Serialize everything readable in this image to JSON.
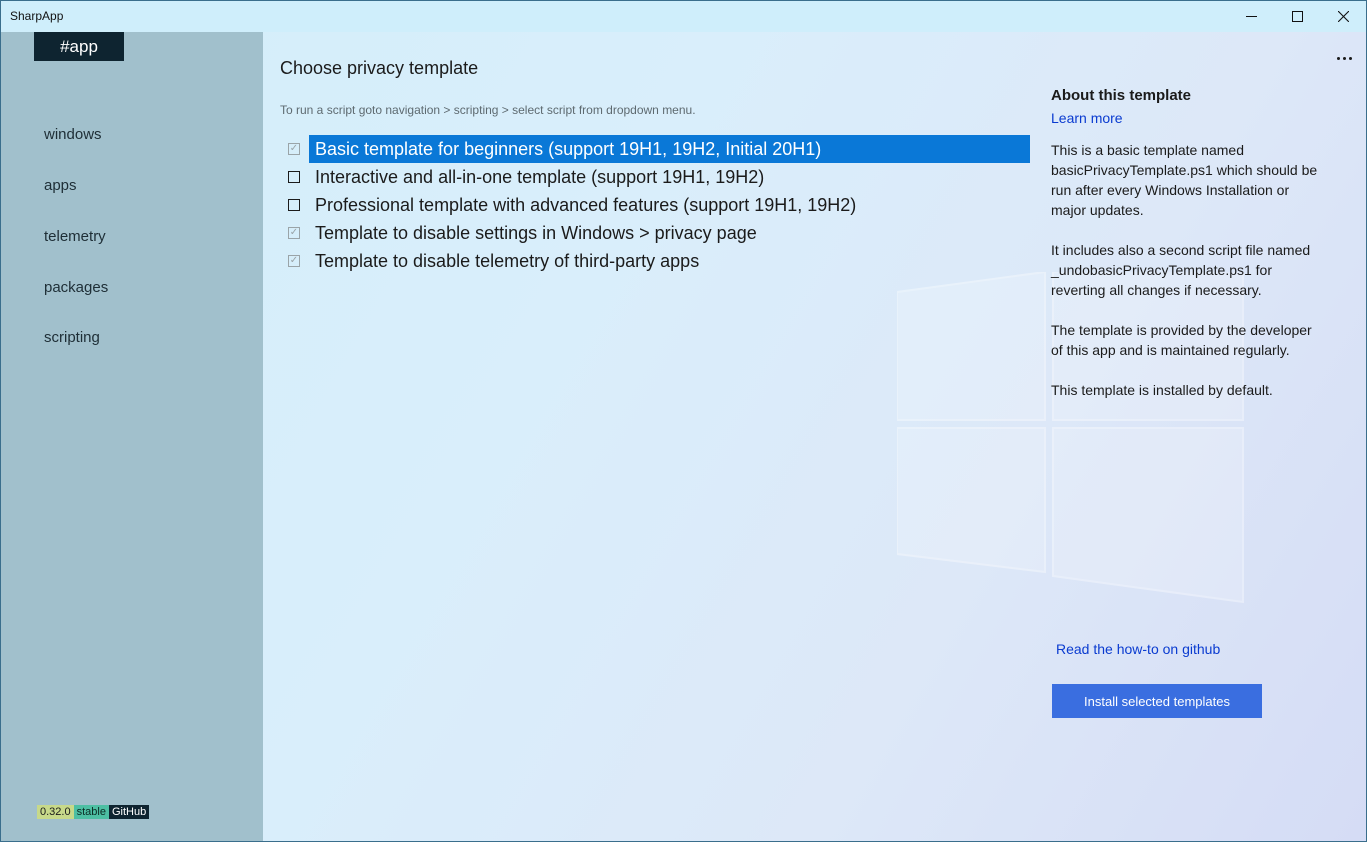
{
  "window": {
    "title": "SharpApp",
    "controls": {
      "minimize": "minimize-icon",
      "maximize": "maximize-icon",
      "close": "close-icon"
    }
  },
  "sidebar": {
    "app_badge": "#app",
    "items": [
      {
        "label": "windows"
      },
      {
        "label": "apps"
      },
      {
        "label": "telemetry"
      },
      {
        "label": "packages"
      },
      {
        "label": "scripting"
      }
    ],
    "badges": {
      "version": "0.32.0",
      "channel": "stable",
      "source": "GitHub"
    }
  },
  "main": {
    "title": "Choose privacy template",
    "hint": "To run a script goto navigation > scripting > select script from dropdown menu.",
    "templates": [
      {
        "label": "Basic template for beginners (support 19H1, 19H2, Initial 20H1)",
        "checked": true,
        "selected": true
      },
      {
        "label": "Interactive and all-in-one template (support 19H1, 19H2)",
        "checked": false,
        "selected": false
      },
      {
        "label": "Professional template with advanced features (support 19H1, 19H2)",
        "checked": false,
        "selected": false
      },
      {
        "label": "Template to disable settings in Windows > privacy page",
        "checked": true,
        "selected": false
      },
      {
        "label": "Template to disable telemetry of third-party apps",
        "checked": true,
        "selected": false
      }
    ],
    "more_icon": "more-icon"
  },
  "about": {
    "title": "About this template",
    "learn_more": "Learn more",
    "paragraphs": [
      "This is a basic template named basicPrivacyTemplate.ps1 which should be run after every Windows Installation or major updates.",
      "It includes also a second script file named _undobasicPrivacyTemplate.ps1 for reverting all changes if necessary.",
      "The template is provided by the developer of this app and is maintained regularly.",
      "This template is installed by default."
    ],
    "github_link": "Read the how-to on github",
    "install_button": "Install selected templates"
  },
  "colors": {
    "sidebar_bg": "#a1c0cc",
    "selection": "#0a78d7",
    "button": "#3a6ee0",
    "link": "#0a3bd0",
    "badge_dark": "#0e2430"
  }
}
